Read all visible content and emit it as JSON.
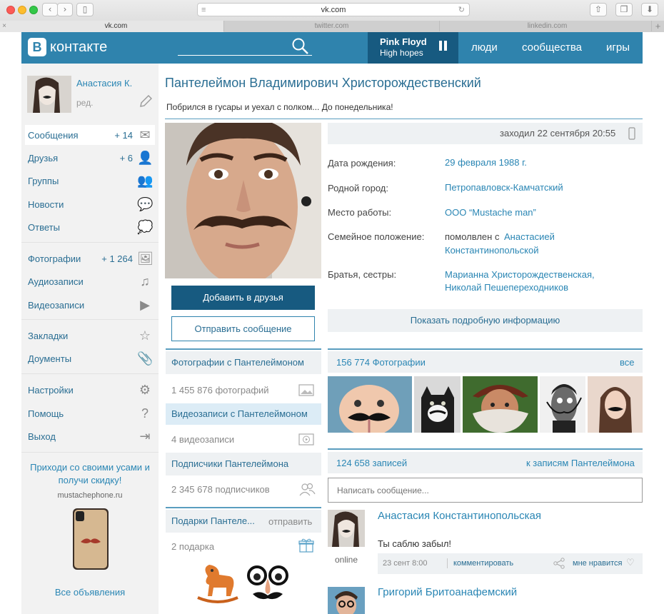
{
  "browser": {
    "url": "vk.com",
    "tabs": [
      "vk.com",
      "twitter.com",
      "linkedin.com"
    ],
    "new_tab": "+"
  },
  "header": {
    "logo_letter": "В",
    "logo_text": "контакте",
    "player_title": "Pink Floyd",
    "player_sub": "High hopes",
    "nav": [
      "люди",
      "сообщества",
      "игры"
    ]
  },
  "sidebar": {
    "user_name": "Анастасия К.",
    "edit_label": "ред.",
    "items": [
      {
        "label": "Сообщения",
        "count": "+ 14"
      },
      {
        "label": "Друзья",
        "count": "+ 6"
      },
      {
        "label": "Группы",
        "count": ""
      },
      {
        "label": "Новости",
        "count": ""
      },
      {
        "label": "Ответы",
        "count": ""
      },
      {
        "label": "Фотографии",
        "count": "+ 1 264"
      },
      {
        "label": "Аудиозаписи",
        "count": ""
      },
      {
        "label": "Видеозаписи",
        "count": ""
      },
      {
        "label": "Закладки",
        "count": ""
      },
      {
        "label": "Доументы",
        "count": ""
      },
      {
        "label": "Настройки",
        "count": ""
      },
      {
        "label": "Помощь",
        "count": ""
      },
      {
        "label": "Выход",
        "count": ""
      }
    ],
    "ad_title": "Приходи со своими усами и получи скидку!",
    "ad_site": "mustachephone.ru",
    "all_ads": "Все объявления"
  },
  "profile": {
    "name": "Пантелеймон Владимирович Христорождественский",
    "status": "Побрился в гусары и уехал с полком... До понедельника!",
    "last_seen": "заходил 22 сентября 20:55",
    "add_friend": "Добавить в друзья",
    "send_message": "Отправить сообщение",
    "info": [
      {
        "label": "Дата рождения:",
        "value": "29 февраля 1988 г."
      },
      {
        "label": "Родной город:",
        "value": "Петропавловск-Камчатский"
      },
      {
        "label": "Место работы:",
        "value": "ООО “Mustache man”"
      }
    ],
    "family_label": "Семейное положение:",
    "family_prefix": "помолвлен с",
    "family_first": "Анастасией",
    "family_second": "Константинопольской",
    "siblings_label": "Братья, сестры:",
    "siblings": [
      "Марианна Христорождественская,",
      "Николай Пешепереходников"
    ],
    "show_more": "Показать подробную информацию"
  },
  "middle": {
    "photos_with": "Фотографии с Пантелеймоном",
    "photos_count": "1 455 876 фотографий",
    "videos_with": "Видеозаписи с Пантелеймоном",
    "videos_count": "4 видеозаписи",
    "subscribers": "Подписчики Пантелеймона",
    "subscribers_count": "2 345 678 подписчиков",
    "gifts": "Подарки Пантеле...",
    "gifts_send": "отправить",
    "gifts_count": "2 подарка"
  },
  "photos": {
    "title": "156 774 Фотографии",
    "all": "все"
  },
  "wall": {
    "count": "124 658 записей",
    "to_posts": "к записям Пантелеймона",
    "placeholder": "Написать сообщение...",
    "posts": [
      {
        "author": "Анастасия Константинопольская",
        "text": "Ты саблю забыл!",
        "online": "online",
        "date": "23 сент 8:00",
        "comment": "комментировать",
        "like": "мне нравится"
      },
      {
        "author": "Григорий Бритоанафемский"
      }
    ]
  },
  "colors": {
    "header": "#2f83ad",
    "accent": "#2a86b4",
    "button": "#175a80"
  }
}
